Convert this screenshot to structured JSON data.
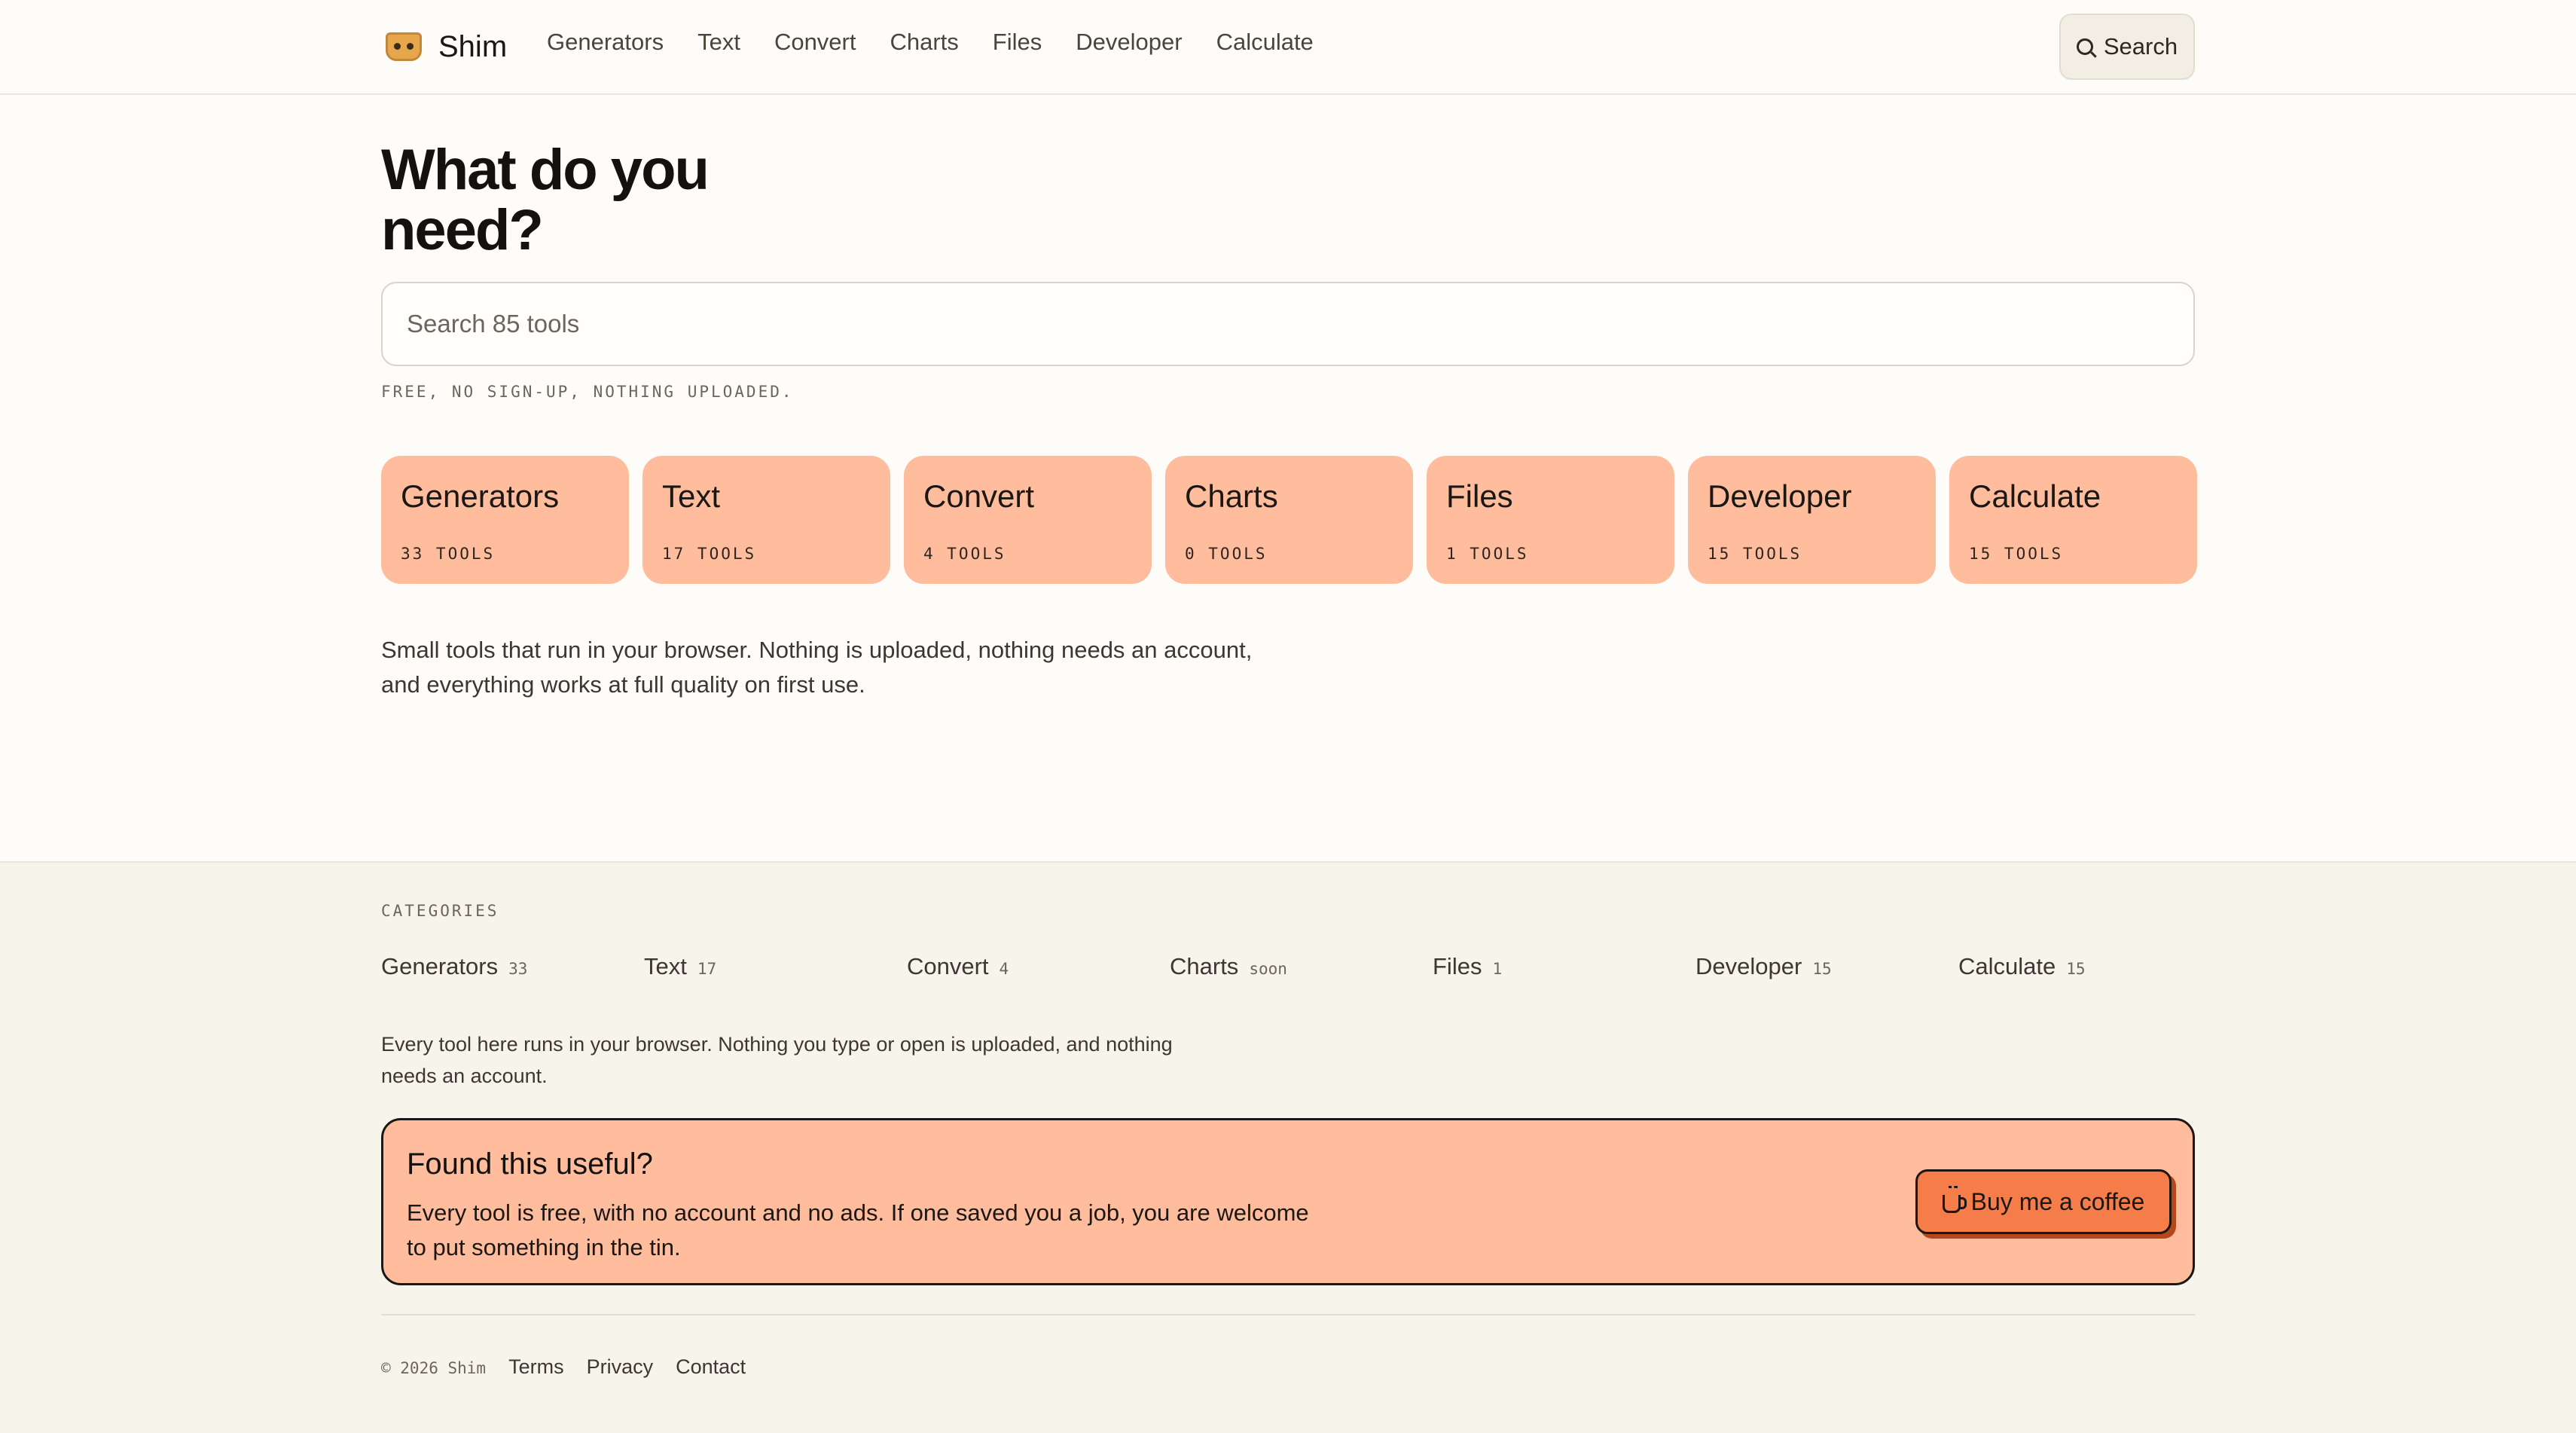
{
  "header": {
    "brand": "Shim",
    "nav": [
      "Generators",
      "Text",
      "Convert",
      "Charts",
      "Files",
      "Developer",
      "Calculate"
    ],
    "search_label": "Search"
  },
  "hero": {
    "title_line1": "What do you",
    "title_line2": "need?",
    "search_placeholder": "Search 85 tools",
    "tagline": "FREE, NO SIGN-UP, NOTHING UPLOADED."
  },
  "cards": [
    {
      "title": "Generators",
      "count": "33 TOOLS"
    },
    {
      "title": "Text",
      "count": "17 TOOLS"
    },
    {
      "title": "Convert",
      "count": "4 TOOLS"
    },
    {
      "title": "Charts",
      "count": "0 TOOLS"
    },
    {
      "title": "Files",
      "count": "1 TOOLS"
    },
    {
      "title": "Developer",
      "count": "15 TOOLS"
    },
    {
      "title": "Calculate",
      "count": "15 TOOLS"
    }
  ],
  "intro": "Small tools that run in your browser. Nothing is uploaded, nothing needs an account, and everything works at full quality on first use.",
  "footer": {
    "categories_heading": "CATEGORIES",
    "categories": [
      {
        "name": "Generators",
        "count": "33"
      },
      {
        "name": "Text",
        "count": "17"
      },
      {
        "name": "Convert",
        "count": "4"
      },
      {
        "name": "Charts",
        "count": "soon"
      },
      {
        "name": "Files",
        "count": "1"
      },
      {
        "name": "Developer",
        "count": "15"
      },
      {
        "name": "Calculate",
        "count": "15"
      }
    ],
    "note": "Every tool here runs in your browser. Nothing you type or open is uploaded, and nothing needs an account.",
    "support": {
      "title": "Found this useful?",
      "text": "Every tool is free, with no account and no ads. If one saved you a job, you are welcome to put something in the tin.",
      "button": "Buy me a coffee"
    },
    "copyright": "© 2026 Shim",
    "links": [
      "Terms",
      "Privacy",
      "Contact"
    ]
  },
  "colors": {
    "accent": "#ffbd9d",
    "button": "#f47d4a",
    "background": "#fefcf8",
    "footer_bg": "#f7f4ec"
  }
}
